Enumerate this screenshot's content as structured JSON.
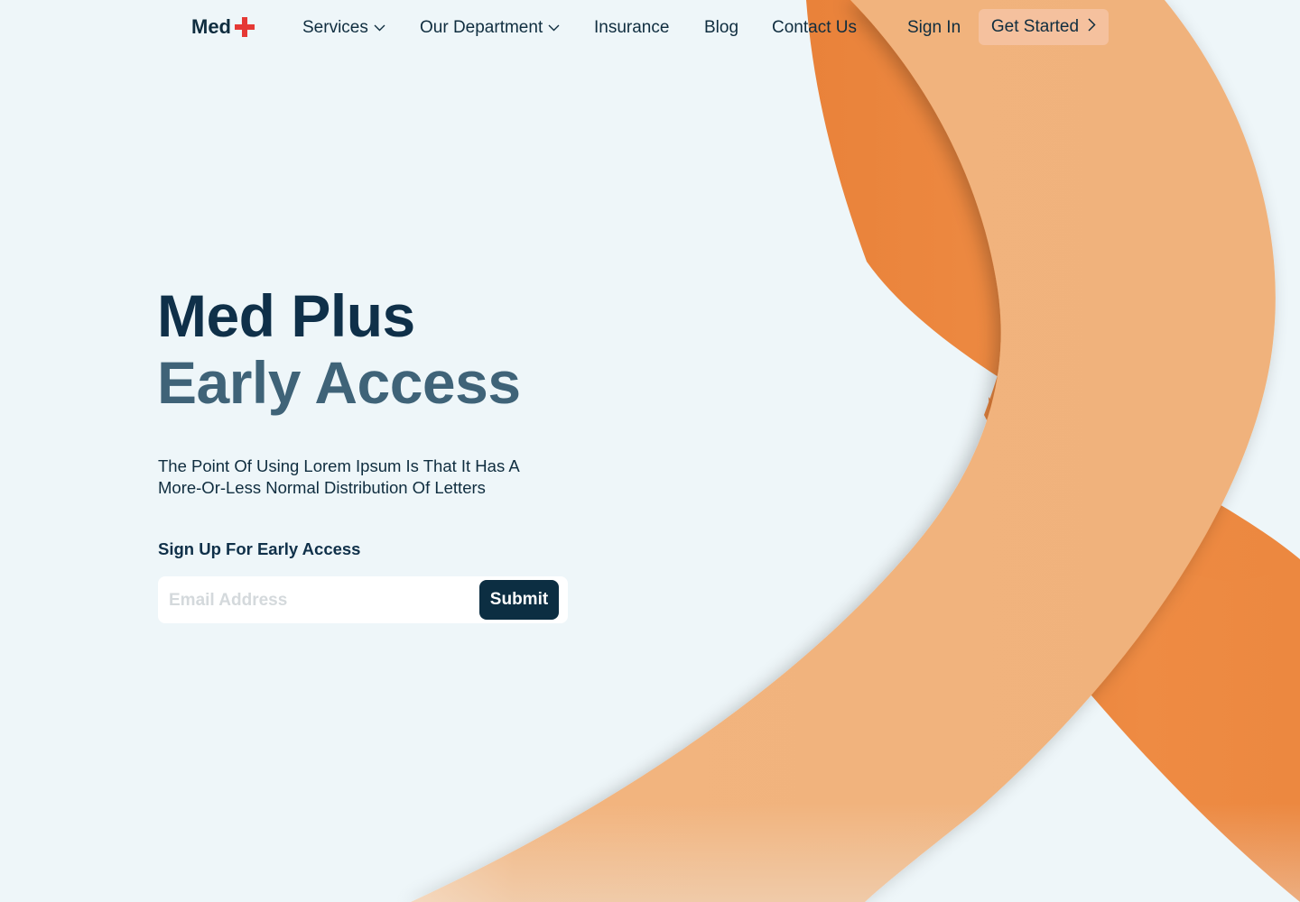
{
  "brand": {
    "name": "Med",
    "icon": "red-cross-icon",
    "icon_color": "#e53935"
  },
  "nav": {
    "items": [
      {
        "label": "Services",
        "has_dropdown": true
      },
      {
        "label": "Our Department",
        "has_dropdown": true
      },
      {
        "label": "Insurance",
        "has_dropdown": false
      },
      {
        "label": "Blog",
        "has_dropdown": false
      },
      {
        "label": "Contact Us",
        "has_dropdown": false
      }
    ],
    "sign_in": "Sign In",
    "get_started": "Get Started",
    "get_started_icon": "chevron-right-icon"
  },
  "hero": {
    "title_line1": "Med Plus",
    "title_line2": "Early Access",
    "description": "The Point Of Using Lorem Ipsum Is That It Has A More-Or-Less Normal Distribution Of Letters",
    "signup_label": "Sign Up For Early Access",
    "email_placeholder": "Email Address",
    "submit_label": "Submit"
  },
  "colors": {
    "background": "#eef6f9",
    "primary_dark": "#0c2e42",
    "secondary_text": "#3f6378",
    "ribbon_light": "#f2b47e",
    "ribbon_dark": "#ed8b42",
    "cta_bg": "#f5c19e"
  }
}
